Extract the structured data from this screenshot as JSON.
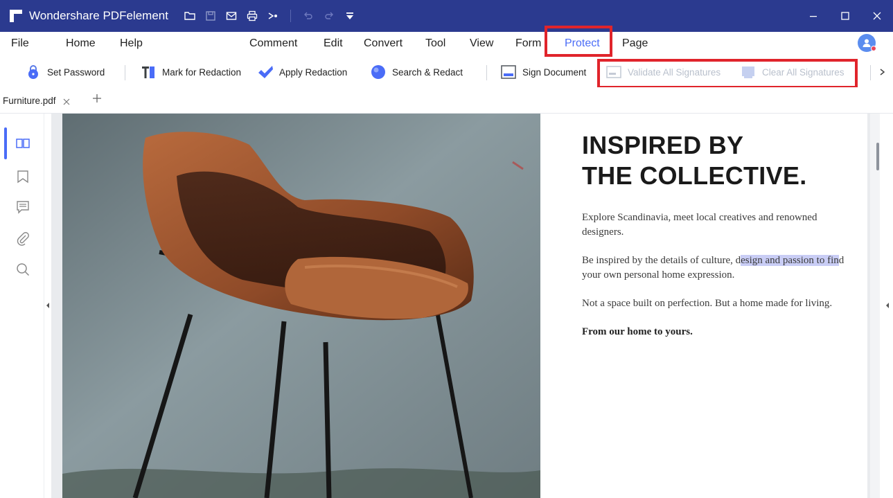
{
  "window": {
    "title": "Wondershare PDFelement"
  },
  "icons": {
    "app_logo": "pdfelement-logo-icon",
    "quick_access": [
      "folder-icon",
      "save-icon",
      "mail-icon",
      "print-icon",
      "share-icon",
      "undo-icon",
      "redo-icon",
      "customize-dropdown-icon"
    ],
    "window_controls": [
      "minimize-icon",
      "maximize-icon",
      "close-icon"
    ]
  },
  "menu": {
    "items": [
      "File",
      "Home",
      "Help",
      "Comment",
      "Edit",
      "Convert",
      "Tool",
      "View",
      "Form",
      "Protect",
      "Page"
    ],
    "active": "Protect"
  },
  "toolbar": {
    "set_password": "Set Password",
    "mark_redaction": "Mark for Redaction",
    "apply_redaction": "Apply Redaction",
    "search_redact": "Search & Redact",
    "sign_document": "Sign Document",
    "validate_signatures": "Validate All Signatures",
    "clear_signatures": "Clear All Signatures"
  },
  "tabs": {
    "file_name": "Furniture.pdf",
    "add_label": "+"
  },
  "sidebar": {
    "items": [
      "thumbnails-icon",
      "bookmark-icon",
      "comment-icon",
      "attachment-icon",
      "search-icon"
    ]
  },
  "document": {
    "heading_line1": "INSPIRED BY",
    "heading_line2": "THE COLLECTIVE.",
    "para1": "Explore Scandinavia, meet local creatives and renowned designers.",
    "para2_before": "Be inspired by the details of culture, d",
    "para2_highlight": "esign and passion to fin",
    "para2_after": "d your own personal home expression.",
    "para3": "Not a space built on perfection. But a home made for living.",
    "para4": "From our home to yours."
  },
  "colors": {
    "titlebar": "#2b3a8f",
    "accent": "#4a6cf7",
    "highlight_box": "#e0242b",
    "text_highlight": "#c9cdf5",
    "disabled_text": "#b9c0cc"
  }
}
